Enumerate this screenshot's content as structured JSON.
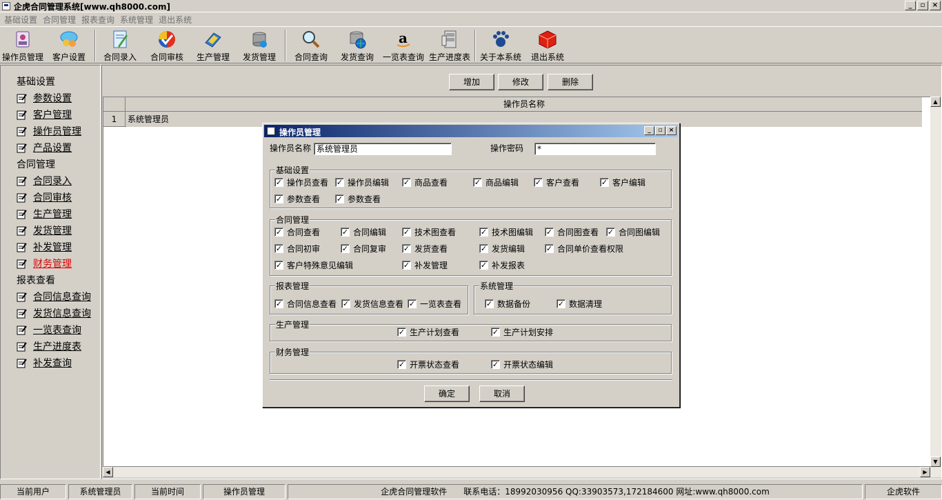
{
  "window": {
    "title": "企虎合同管理系统[www.qh8000.com]",
    "controls": [
      "_",
      "▫",
      "×"
    ]
  },
  "menu": [
    "基础设置",
    "合同管理",
    "报表查询",
    "系统管理",
    "退出系统"
  ],
  "toolbar": [
    {
      "label": "操作员管理",
      "icon": "operator-icon"
    },
    {
      "label": "客户设置",
      "icon": "customer-icon"
    },
    {
      "label": "合同录入",
      "icon": "contract-entry-icon"
    },
    {
      "label": "合同审核",
      "icon": "contract-review-icon"
    },
    {
      "label": "生产管理",
      "icon": "production-icon"
    },
    {
      "label": "发货管理",
      "icon": "shipping-icon"
    },
    {
      "label": "合同查询",
      "icon": "magnifier-icon"
    },
    {
      "label": "发货查询",
      "icon": "database-globe-icon"
    },
    {
      "label": "一览表查询",
      "icon": "amazon-icon"
    },
    {
      "label": "生产进度表",
      "icon": "cabinet-icon"
    },
    {
      "label": "关于本系统",
      "icon": "paw-icon"
    },
    {
      "label": "退出系统",
      "icon": "red-cube-icon"
    }
  ],
  "sidebar": {
    "groups": [
      {
        "title": "基础设置",
        "items": [
          "参数设置",
          "客户管理",
          "操作员管理",
          "产品设置"
        ]
      },
      {
        "title": "合同管理",
        "items": [
          "合同录入",
          "合同审核",
          "生产管理",
          "发货管理",
          "补发管理",
          "财务管理"
        ]
      },
      {
        "title": "报表查看",
        "items": [
          "合同信息查询",
          "发货信息查询",
          "一览表查询",
          "生产进度表",
          "补发查询"
        ]
      }
    ],
    "active_item": "财务管理"
  },
  "actions": {
    "add": "增加",
    "edit": "修改",
    "delete": "删除"
  },
  "grid": {
    "column": "操作员名称",
    "rows": [
      {
        "num": "1",
        "name": "系统管理员"
      }
    ]
  },
  "dialog": {
    "title": "操作员管理",
    "name_label": "操作员名称",
    "name_value": "系统管理员",
    "password_label": "操作密码",
    "password_value": "*",
    "groups": {
      "basic": {
        "title": "基础设置",
        "items": [
          "操作员查看",
          "操作员编辑",
          "商品查看",
          "商品编辑",
          "客户查看",
          "客户编辑",
          "参数查看",
          "参数查看"
        ]
      },
      "contract": {
        "title": "合同管理",
        "items": [
          "合同查看",
          "合同编辑",
          "技术图查看",
          "技术图编辑",
          "合同图查看",
          "合同图编辑",
          "合同初审",
          "合同复审",
          "发货查看",
          "发货编辑",
          "合同单价查看权限",
          "客户特殊意见编辑",
          "补发管理",
          "补发报表"
        ]
      },
      "report": {
        "title": "报表管理",
        "items": [
          "合同信息查看",
          "发货信息查看",
          "一览表查看"
        ]
      },
      "system": {
        "title": "系统管理",
        "items": [
          "数据备份",
          "数据清理"
        ]
      },
      "production": {
        "title": "生产管理",
        "items": [
          "生产计划查看",
          "生产计划安排"
        ]
      },
      "finance": {
        "title": "财务管理",
        "items": [
          "开票状态查看",
          "开票状态编辑"
        ]
      }
    },
    "ok": "确定",
    "cancel": "取消"
  },
  "status": {
    "user_label": "当前用户",
    "user_value": "系统管理员",
    "time_label": "当前时间",
    "current_module": "操作员管理",
    "software": "企虎合同管理软件",
    "contact": "联系电话：18992030956 QQ:33903573,172184600 网址:www.qh8000.com",
    "brand": "企虎软件"
  }
}
